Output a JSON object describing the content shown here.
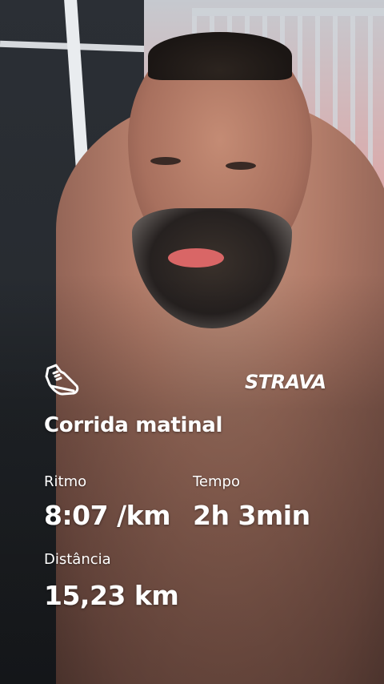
{
  "activity": {
    "title": "Corrida matinal"
  },
  "brand": {
    "logo_text": "STRAVA",
    "activity_icon": "running-shoe-icon"
  },
  "stats": {
    "pace": {
      "label": "Ritmo",
      "value": "8:07 /km"
    },
    "time": {
      "label": "Tempo",
      "value": "2h 3min"
    },
    "distance": {
      "label": "Distância",
      "value": "15,23 km"
    }
  },
  "colors": {
    "text": "#ffffff",
    "road_marker": "#e34b4b"
  }
}
